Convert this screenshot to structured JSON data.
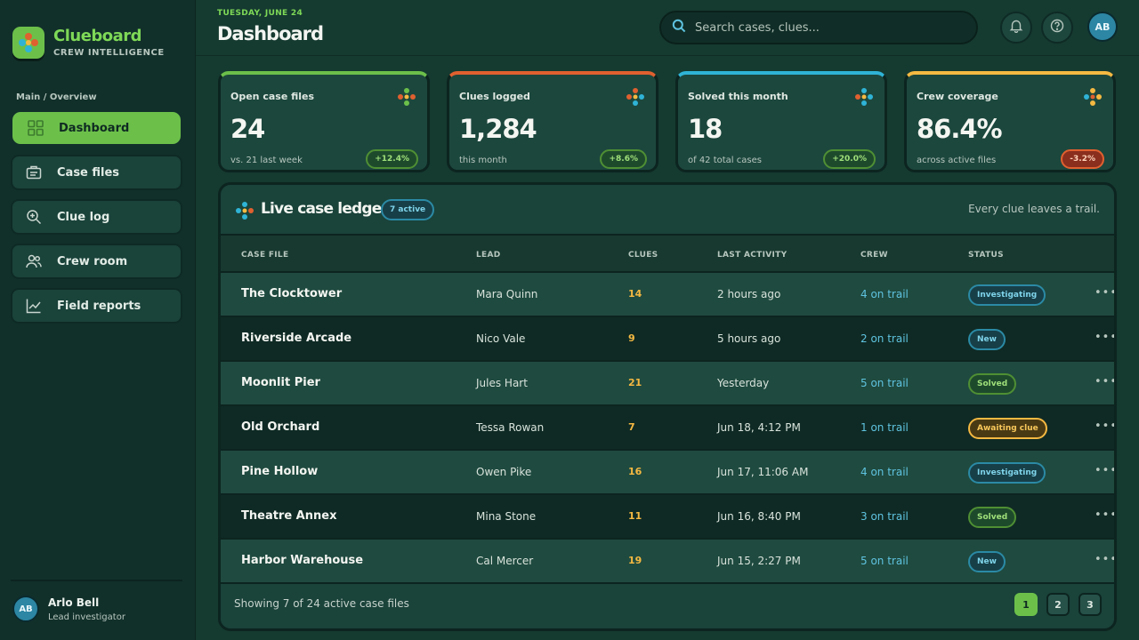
{
  "brand": {
    "name": "Clueboard",
    "subtitle": "CREW INTELLIGENCE",
    "accent": "#7ed957"
  },
  "sidebar": {
    "section_label": "Main / Overview",
    "items": [
      {
        "label": "Dashboard",
        "icon": "grid-icon",
        "active": true
      },
      {
        "label": "Case files",
        "icon": "briefcase-icon"
      },
      {
        "label": "Clue log",
        "icon": "magnifier-plus-icon"
      },
      {
        "label": "Crew room",
        "icon": "users-icon"
      },
      {
        "label": "Field reports",
        "icon": "chart-line-icon"
      }
    ],
    "profile": {
      "initials": "AB",
      "name": "Arlo Bell",
      "role": "Lead investigator"
    }
  },
  "header": {
    "date": "TUESDAY, JUNE 24",
    "title": "Dashboard",
    "search_placeholder": "Search cases, clues...",
    "avatar_initials": "AB"
  },
  "stats": [
    {
      "label": "Open case files",
      "value": "24",
      "note": "vs. 21 last week",
      "delta": "+12.4%",
      "trend": "up",
      "color": "#6cc04a"
    },
    {
      "label": "Clues logged",
      "value": "1,284",
      "note": "this month",
      "delta": "+8.6%",
      "trend": "up",
      "color": "#e0602f"
    },
    {
      "label": "Solved this month",
      "value": "18",
      "note": "of 42 total cases",
      "delta": "+20.0%",
      "trend": "up",
      "color": "#2fb3d6"
    },
    {
      "label": "Crew coverage",
      "value": "86.4%",
      "note": "across active files",
      "delta": "-3.2%",
      "trend": "down",
      "color": "#f5b942"
    }
  ],
  "ledger": {
    "title": "Live case ledger",
    "badge": "7 active",
    "tagline": "Every clue leaves a trail.",
    "columns": [
      "CASE FILE",
      "LEAD",
      "CLUES",
      "LAST ACTIVITY",
      "CREW",
      "STATUS"
    ],
    "rows": [
      {
        "name": "The Clocktower",
        "lead": "Mara Quinn",
        "clues": "14",
        "activity": "2 hours ago",
        "crew": "4 on trail",
        "status": "Investigating",
        "kind": "investigating"
      },
      {
        "name": "Riverside Arcade",
        "lead": "Nico Vale",
        "clues": "9",
        "activity": "5 hours ago",
        "crew": "2 on trail",
        "status": "New",
        "kind": "new"
      },
      {
        "name": "Moonlit Pier",
        "lead": "Jules Hart",
        "clues": "21",
        "activity": "Yesterday",
        "crew": "5 on trail",
        "status": "Solved",
        "kind": "solved"
      },
      {
        "name": "Old Orchard",
        "lead": "Tessa Rowan",
        "clues": "7",
        "activity": "Jun 18, 4:12 PM",
        "crew": "1 on trail",
        "status": "Awaiting clue",
        "kind": "awaiting"
      },
      {
        "name": "Pine Hollow",
        "lead": "Owen Pike",
        "clues": "16",
        "activity": "Jun 17, 11:06 AM",
        "crew": "4 on trail",
        "status": "Investigating",
        "kind": "investigating"
      },
      {
        "name": "Theatre Annex",
        "lead": "Mina Stone",
        "clues": "11",
        "activity": "Jun 16, 8:40 PM",
        "crew": "3 on trail",
        "status": "Solved",
        "kind": "solved"
      },
      {
        "name": "Harbor Warehouse",
        "lead": "Cal Mercer",
        "clues": "19",
        "activity": "Jun 15, 2:27 PM",
        "crew": "5 on trail",
        "status": "New",
        "kind": "new"
      }
    ],
    "footer_text": "Showing 7 of 24 active case files",
    "pages": [
      "1",
      "2",
      "3"
    ],
    "current_page": "1"
  }
}
